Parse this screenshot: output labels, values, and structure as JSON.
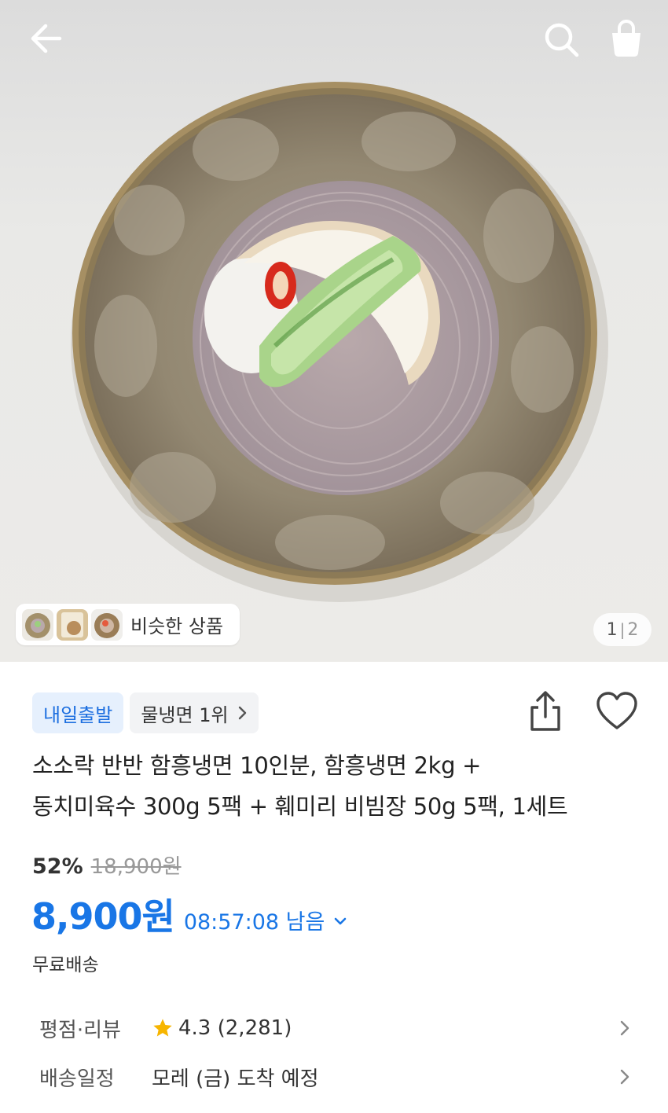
{
  "header": {
    "back_icon": "arrow-left-icon",
    "search_icon": "search-icon",
    "cart_icon": "shopping-bag-icon"
  },
  "gallery": {
    "similar_label": "비슷한 상품",
    "current_page": "1",
    "separator": "|",
    "total_pages": "2"
  },
  "product": {
    "badge_primary": "내일출발",
    "badge_rank": "물냉면 1위",
    "title_line1": "소소락 반반 함흥냉면 10인분, 함흥냉면 2kg +",
    "title_line2": "동치미육수 300g 5팩 + 훼미리 비빔장 50g 5팩, 1세트",
    "discount": "52%",
    "original_price": "18,900원",
    "price": "8,900원",
    "timer": "08:57:08 남음",
    "shipping": "무료배송"
  },
  "details": {
    "rating_label": "평점·리뷰",
    "rating_value": "4.3 (2,281)",
    "delivery_label": "배송일정",
    "delivery_value": "모레 (금) 도착 예정"
  },
  "colors": {
    "accent": "#1976e6",
    "badge_blue_bg": "#e6f0fd",
    "star": "#f7b500"
  }
}
